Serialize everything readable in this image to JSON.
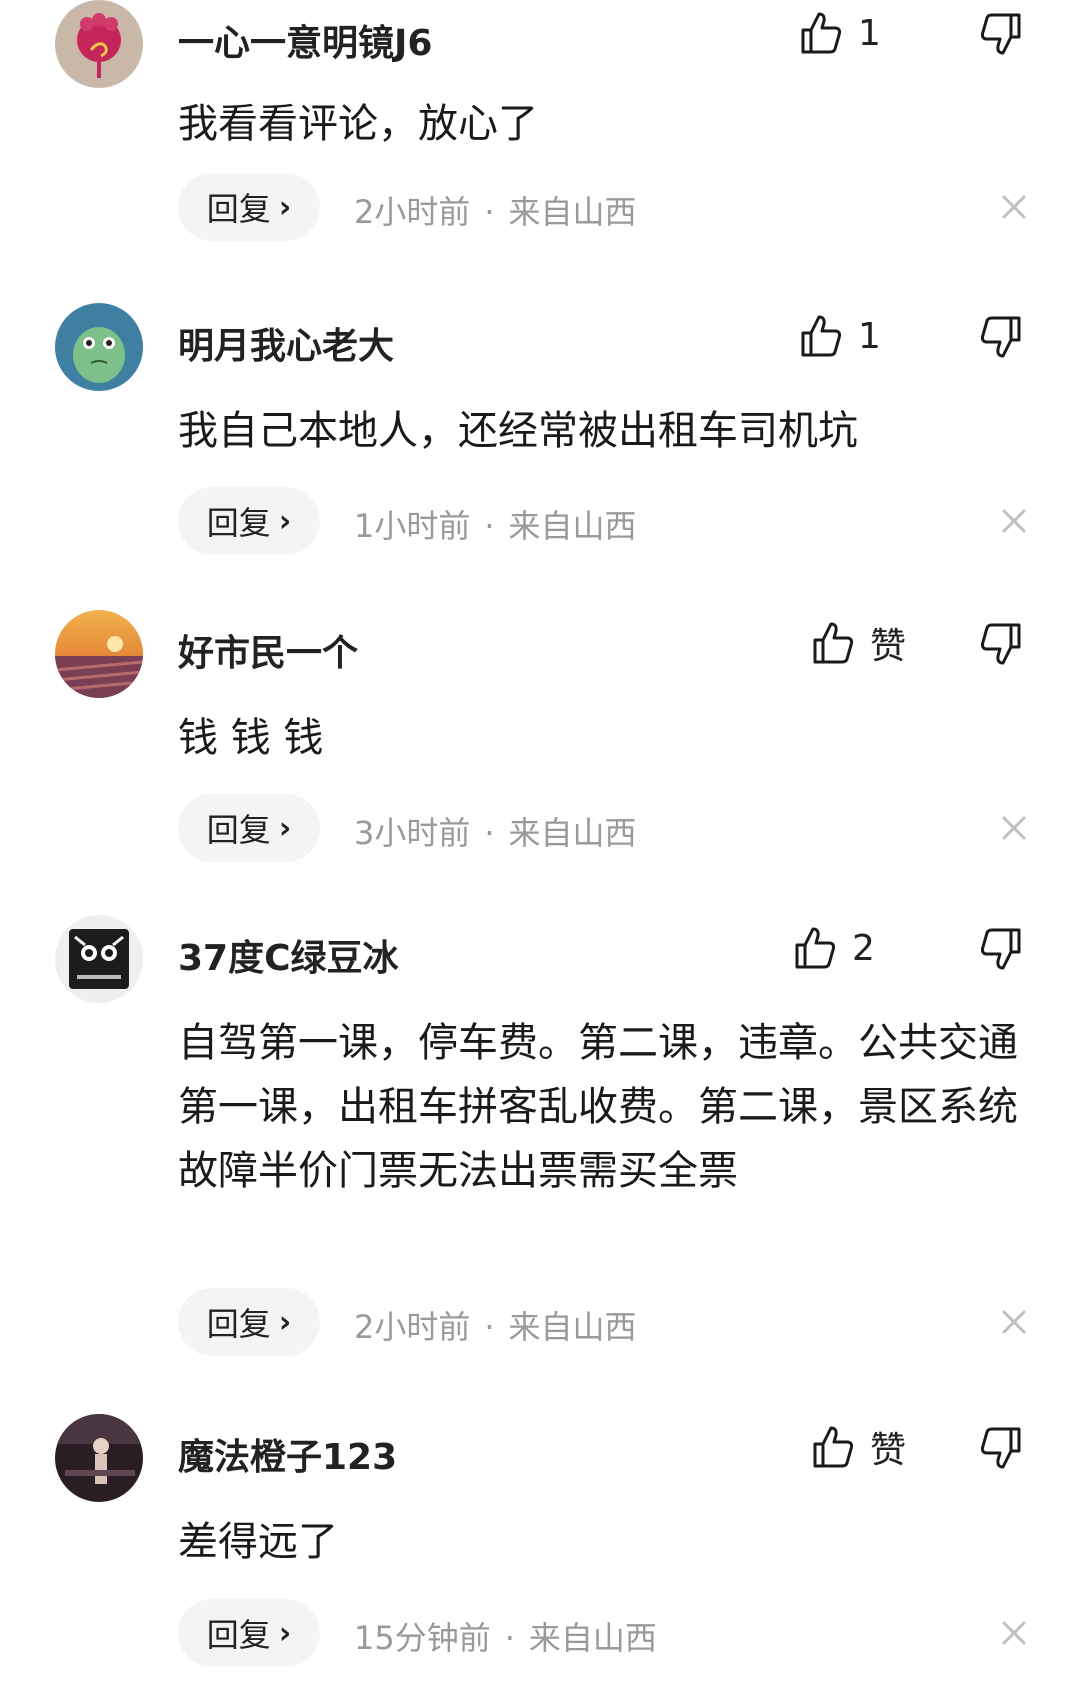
{
  "comments": [
    {
      "username": "一心一意明镜J6",
      "like_label": "1",
      "content": "我看看评论，放心了",
      "reply_label": "回复",
      "reply_chevron": "›",
      "time": "2小时前",
      "separator": "·",
      "location": "来自山西"
    },
    {
      "username": "明月我心老大",
      "like_label": "1",
      "content": "我自己本地人，还经常被出租车司机坑",
      "reply_label": "回复",
      "reply_chevron": "›",
      "time": "1小时前",
      "separator": "·",
      "location": "来自山西"
    },
    {
      "username": "好市民一个",
      "like_label": "赞",
      "content": "钱 钱 钱",
      "reply_label": "回复",
      "reply_chevron": "›",
      "time": "3小时前",
      "separator": "·",
      "location": "来自山西"
    },
    {
      "username": "37度C绿豆冰",
      "like_label": "2",
      "content": "自驾第一课，停车费。第二课，违章。公共交通第一课，出租车拼客乱收费。第二课，景区系统故障半价门票无法出票需买全票",
      "reply_label": "回复",
      "reply_chevron": "›",
      "time": "2小时前",
      "separator": "·",
      "location": "来自山西"
    },
    {
      "username": "魔法橙子123",
      "like_label": "赞",
      "content": "差得远了",
      "reply_label": "回复",
      "reply_chevron": "›",
      "time": "15分钟前",
      "separator": "·",
      "location": "来自山西"
    }
  ],
  "icons": {
    "like": "thumbs-up-icon",
    "dislike": "thumbs-down-icon",
    "close": "close-icon"
  },
  "colors": {
    "text_primary": "#1a1a1a",
    "text_secondary": "#9a9a9a",
    "reply_bg": "#f4f4f4"
  }
}
